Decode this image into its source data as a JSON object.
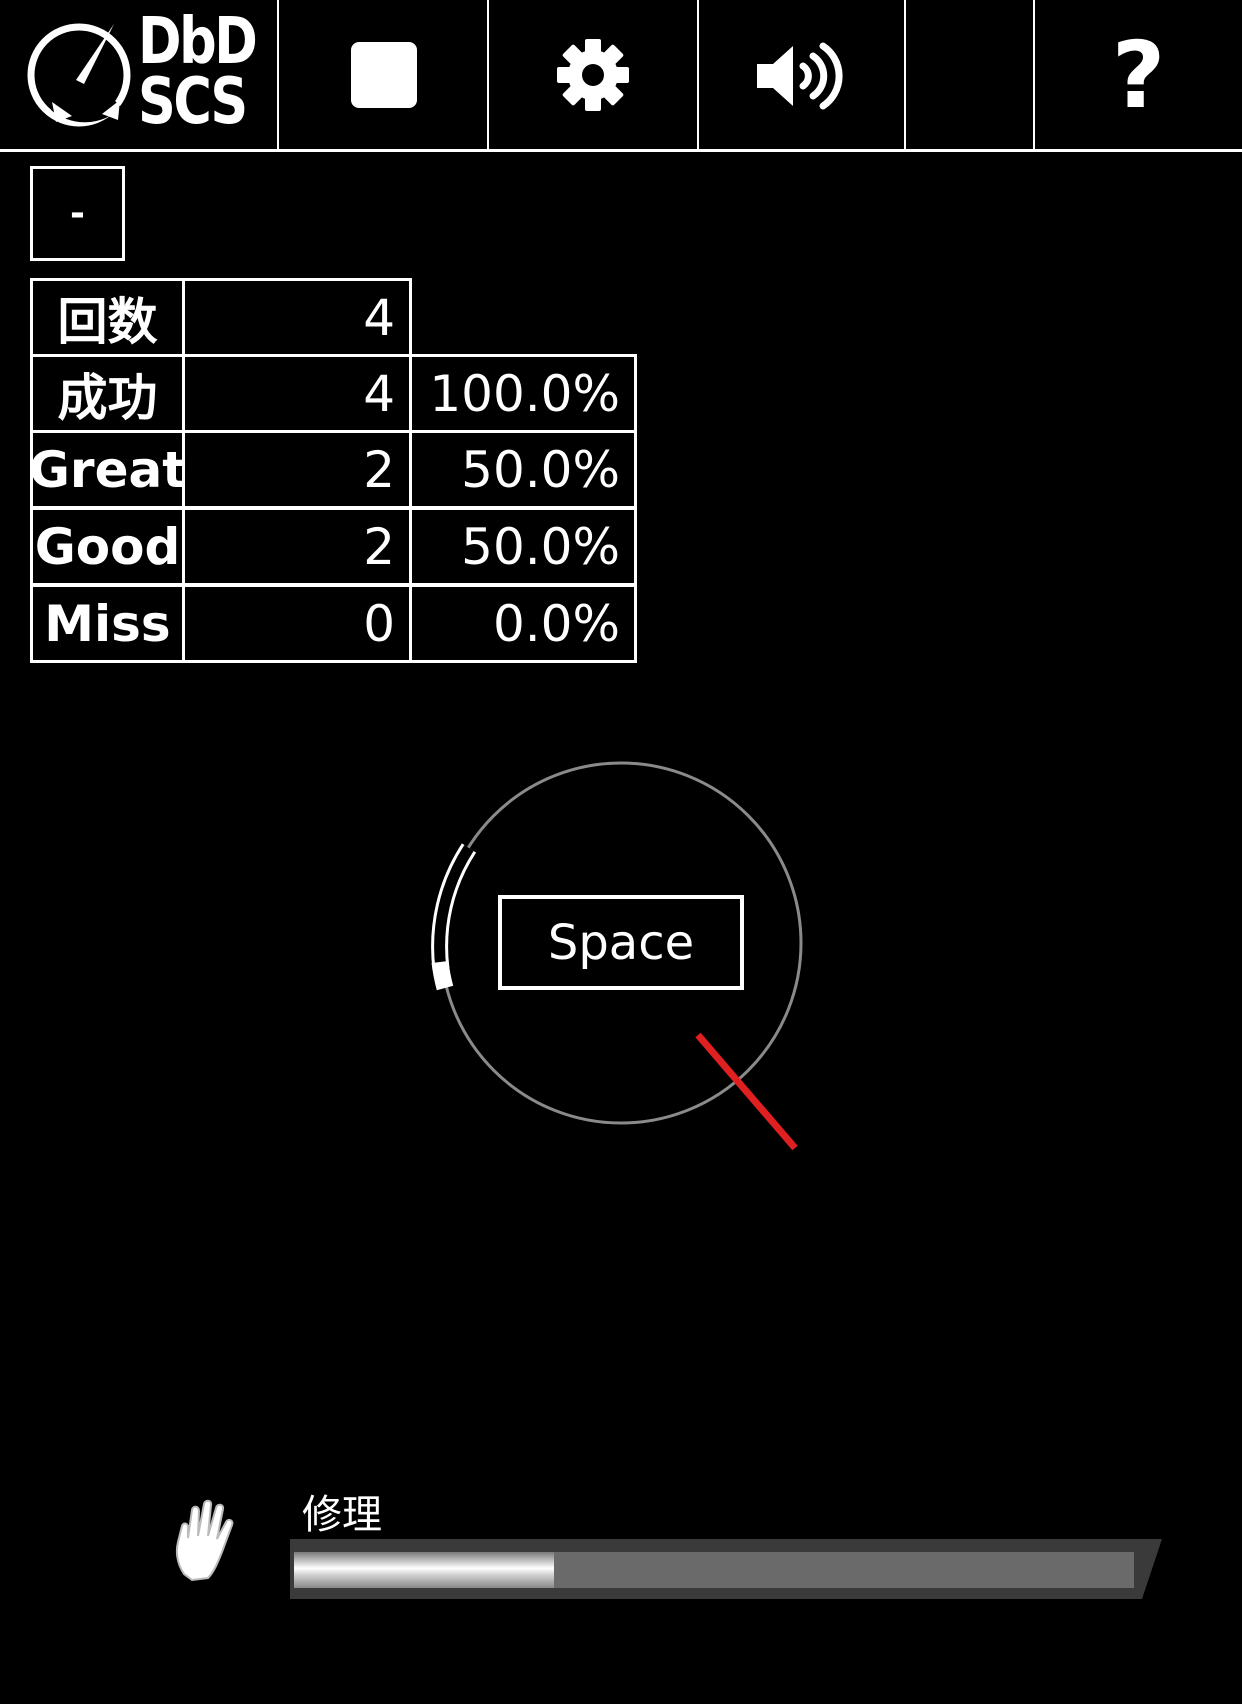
{
  "toolbar": {
    "logo_line1": "DbD",
    "logo_line2": "SCS",
    "buttons": [
      {
        "name": "stop",
        "icon": "stop-icon"
      },
      {
        "name": "settings",
        "icon": "gear-icon"
      },
      {
        "name": "volume",
        "icon": "speaker-icon"
      },
      {
        "name": "blank",
        "icon": ""
      },
      {
        "name": "help",
        "icon": "question-icon",
        "label": "?"
      }
    ]
  },
  "collapse_button": {
    "label": "-"
  },
  "stats": {
    "rows": [
      {
        "label": "回数",
        "count": "4",
        "percent": ""
      },
      {
        "label": "成功",
        "count": "4",
        "percent": "100.0%"
      },
      {
        "label": "Great",
        "count": "2",
        "percent": "50.0%"
      },
      {
        "label": "Good",
        "count": "2",
        "percent": "50.0%"
      },
      {
        "label": "Miss",
        "count": "0",
        "percent": "0.0%"
      }
    ]
  },
  "skill_check": {
    "key_label": "Space",
    "needle_color": "#e02020"
  },
  "repair": {
    "label": "修理",
    "icon": "hand-icon",
    "progress": 0.31
  }
}
